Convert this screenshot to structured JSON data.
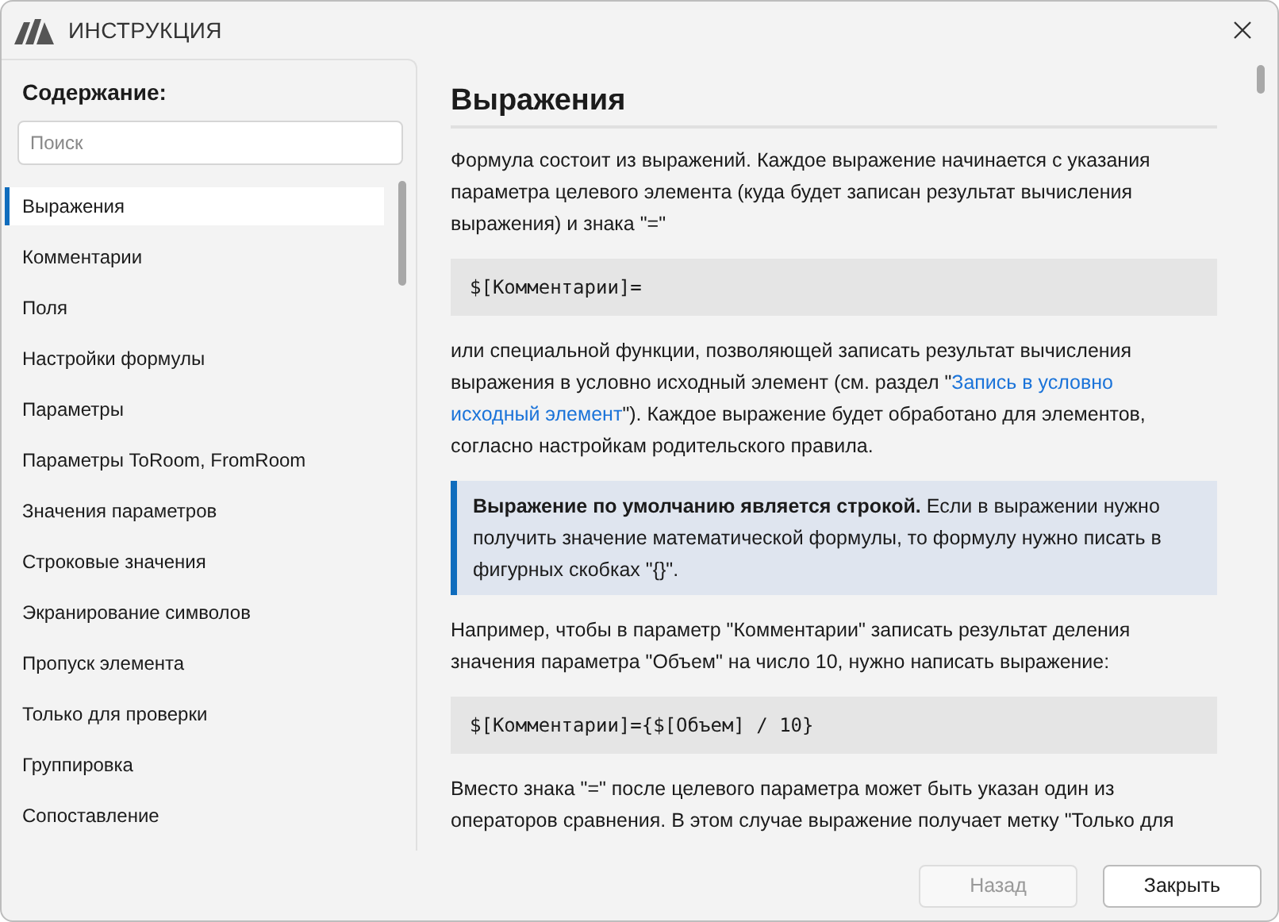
{
  "window": {
    "title": "ИНСТРУКЦИЯ"
  },
  "sidebar": {
    "heading": "Содержание:",
    "search": {
      "placeholder": "Поиск"
    },
    "items": [
      {
        "label": "Выражения",
        "selected": true
      },
      {
        "label": "Комментарии",
        "selected": false
      },
      {
        "label": "Поля",
        "selected": false
      },
      {
        "label": "Настройки формулы",
        "selected": false
      },
      {
        "label": "Параметры",
        "selected": false
      },
      {
        "label": "Параметры ToRoom, FromRoom",
        "selected": false
      },
      {
        "label": "Значения параметров",
        "selected": false
      },
      {
        "label": "Строковые значения",
        "selected": false
      },
      {
        "label": "Экранирование символов",
        "selected": false
      },
      {
        "label": "Пропуск элемента",
        "selected": false
      },
      {
        "label": "Только для проверки",
        "selected": false
      },
      {
        "label": "Группировка",
        "selected": false
      },
      {
        "label": "Сопоставление",
        "selected": false
      }
    ]
  },
  "article": {
    "title": "Выражения",
    "blocks": [
      {
        "kind": "paragraph",
        "parts": [
          {
            "kind": "text",
            "text": "Формула состоит из выражений. Каждое выражение начинается с указания параметра целевого элемента (куда будет записан результат вычисления выражения) и знака \"=\""
          }
        ]
      },
      {
        "kind": "code",
        "text": "$[Комментарии]="
      },
      {
        "kind": "paragraph",
        "parts": [
          {
            "kind": "text",
            "text": "или специальной функции, позволяющей записать результат вычисления выражения в условно исходный элемент (см. раздел \""
          },
          {
            "kind": "link",
            "text": "Запись в условно"
          },
          {
            "kind": "link",
            "text": "исходный элемент"
          },
          {
            "kind": "text",
            "text": "\"). Каждое выражение будет обработано для элементов, согласно настройкам родительского правила."
          }
        ]
      },
      {
        "kind": "note",
        "text": "**Выражение по умолчанию является строкой.** Если в выражении нужно получить значение математической формулы, то формулу нужно писать в фигурных скобках \"{}\"."
      },
      {
        "kind": "paragraph",
        "parts": [
          {
            "kind": "text",
            "text": "Например, чтобы в параметр \"Комментарии\" записать результат деления значения параметра \"Объем\" на число 10, нужно написать выражение:"
          }
        ]
      },
      {
        "kind": "code",
        "text": "$[Комментарии]={$[Объем] / 10}"
      },
      {
        "kind": "paragraph",
        "parts": [
          {
            "kind": "text",
            "text": "Вместо знака \"=\" после целевого параметра может быть указан один из операторов сравнения. В этом случае выражение получает метку \"Только для"
          }
        ]
      }
    ]
  },
  "buttons": [
    {
      "label": "Назад",
      "disabled": true
    },
    {
      "label": "Закрыть",
      "disabled": false
    }
  ]
}
